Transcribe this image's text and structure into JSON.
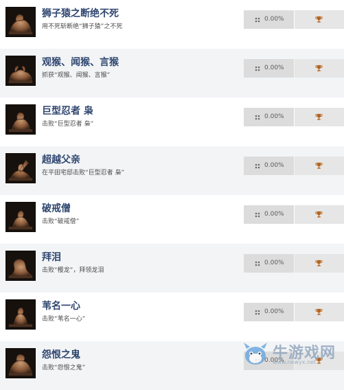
{
  "achievements": [
    {
      "title": "狮子猿之断绝不死",
      "description": "用不死斩断绝“狮子猿”之不死",
      "percent": "0.00%",
      "icon": "lion-ape-statue"
    },
    {
      "title": "观猴、闻猴、言猴",
      "description": "抓获“观猴、闻猴、言猴”",
      "percent": "0.00%",
      "icon": "monkeys-statue"
    },
    {
      "title": "巨型忍者 枭",
      "description": "击败“巨型忍者 枭”",
      "percent": "0.00%",
      "icon": "owl-statue"
    },
    {
      "title": "超越父亲",
      "description": "在平田宅邸击败“巨型忍者 枭”",
      "percent": "0.00%",
      "icon": "father-statue"
    },
    {
      "title": "破戒僧",
      "description": "击败“破戒僧”",
      "percent": "0.00%",
      "icon": "monk-statue"
    },
    {
      "title": "拜泪",
      "description": "击败“樱龙”，拜领龙泪",
      "percent": "0.00%",
      "icon": "dragon-statue"
    },
    {
      "title": "苇名一心",
      "description": "击败“苇名一心”",
      "percent": "0.00%",
      "icon": "isshin-statue"
    },
    {
      "title": "怨恨之鬼",
      "description": "击败“怨恨之鬼”",
      "percent": "0.00%",
      "icon": "demon-statue"
    }
  ],
  "watermark": {
    "text": "牛游戏网",
    "url": "www.newyx.net"
  },
  "colors": {
    "title": "#2f4670",
    "trophy": "#b5651d",
    "percent_bg": "#dcdcdc",
    "alt_row": "#f3f4f6"
  },
  "icons": {
    "percent": "grid-dots-icon",
    "trophy": "trophy-icon"
  }
}
